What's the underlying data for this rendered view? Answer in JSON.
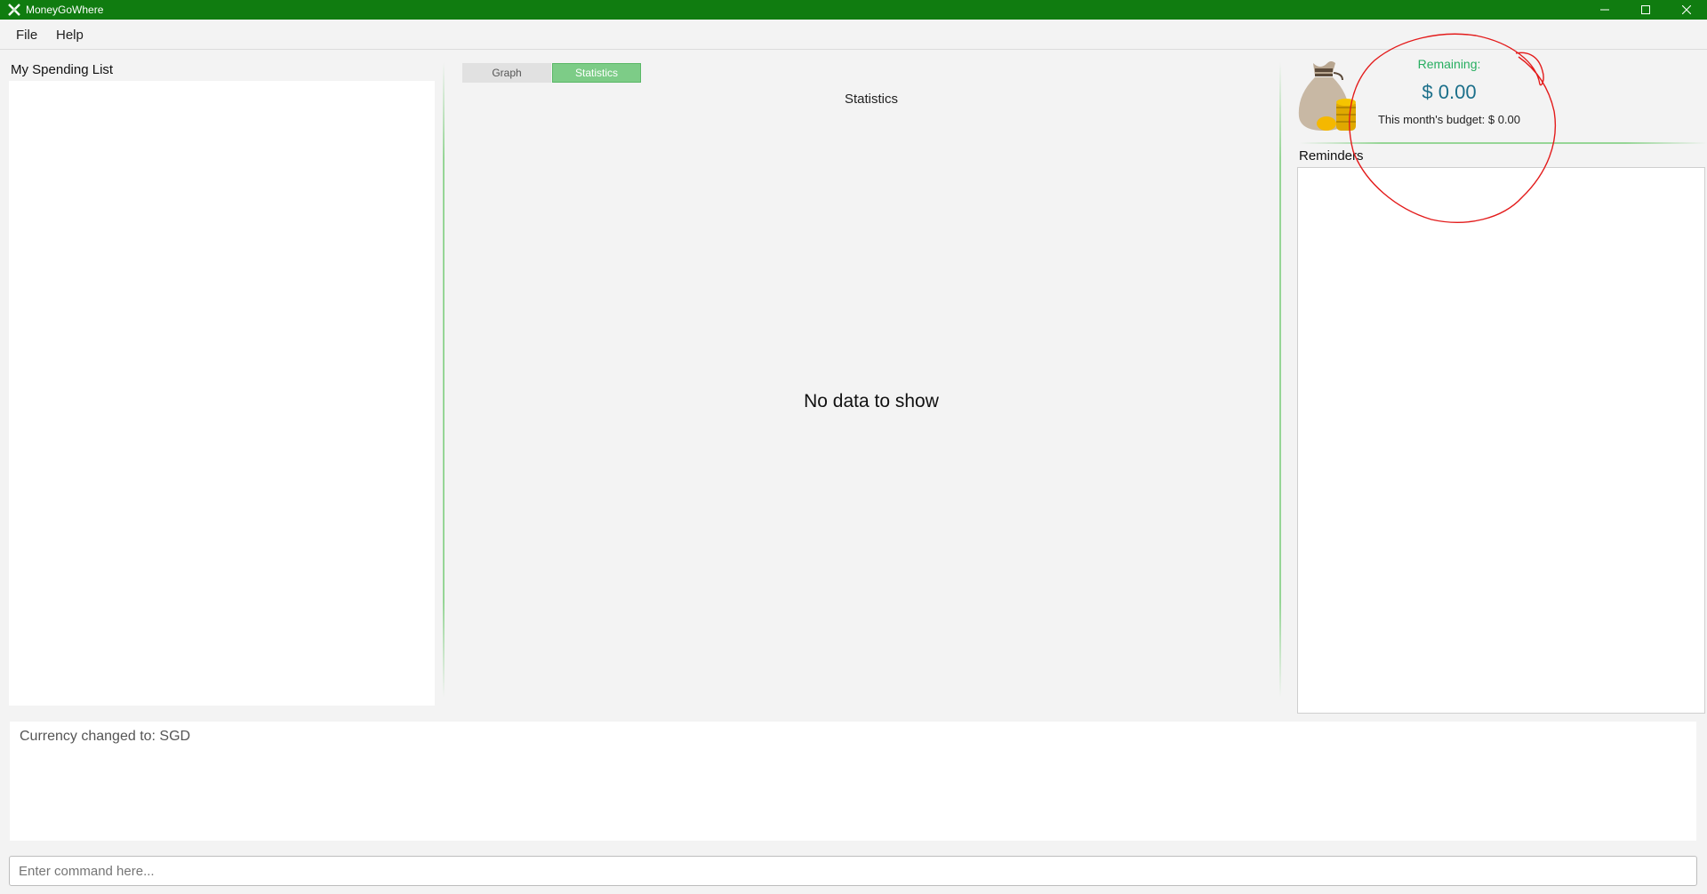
{
  "window": {
    "title": "MoneyGoWhere"
  },
  "menu": {
    "file": "File",
    "help": "Help"
  },
  "spending": {
    "title": "My Spending List"
  },
  "tabs": {
    "graph": "Graph",
    "statistics": "Statistics"
  },
  "stats": {
    "heading": "Statistics",
    "empty": "No data to show"
  },
  "budget": {
    "remaining_label": "Remaining:",
    "remaining_value": "$ 0.00",
    "monthly": "This month's budget: $ 0.00"
  },
  "reminders": {
    "title": "Reminders"
  },
  "output": {
    "text": "Currency changed to: SGD"
  },
  "command": {
    "placeholder": "Enter command here..."
  },
  "colors": {
    "titlebar": "#107c10",
    "accent_green": "#7dcc87",
    "remaining_green": "#27ae60",
    "remaining_value": "#1b6f8a",
    "annotation_red": "#e31b1b"
  },
  "icons": {
    "app": "app-logo-icon",
    "minimize": "minimize-icon",
    "maximize": "maximize-icon",
    "close": "close-icon",
    "moneybag": "money-bag-icon"
  }
}
